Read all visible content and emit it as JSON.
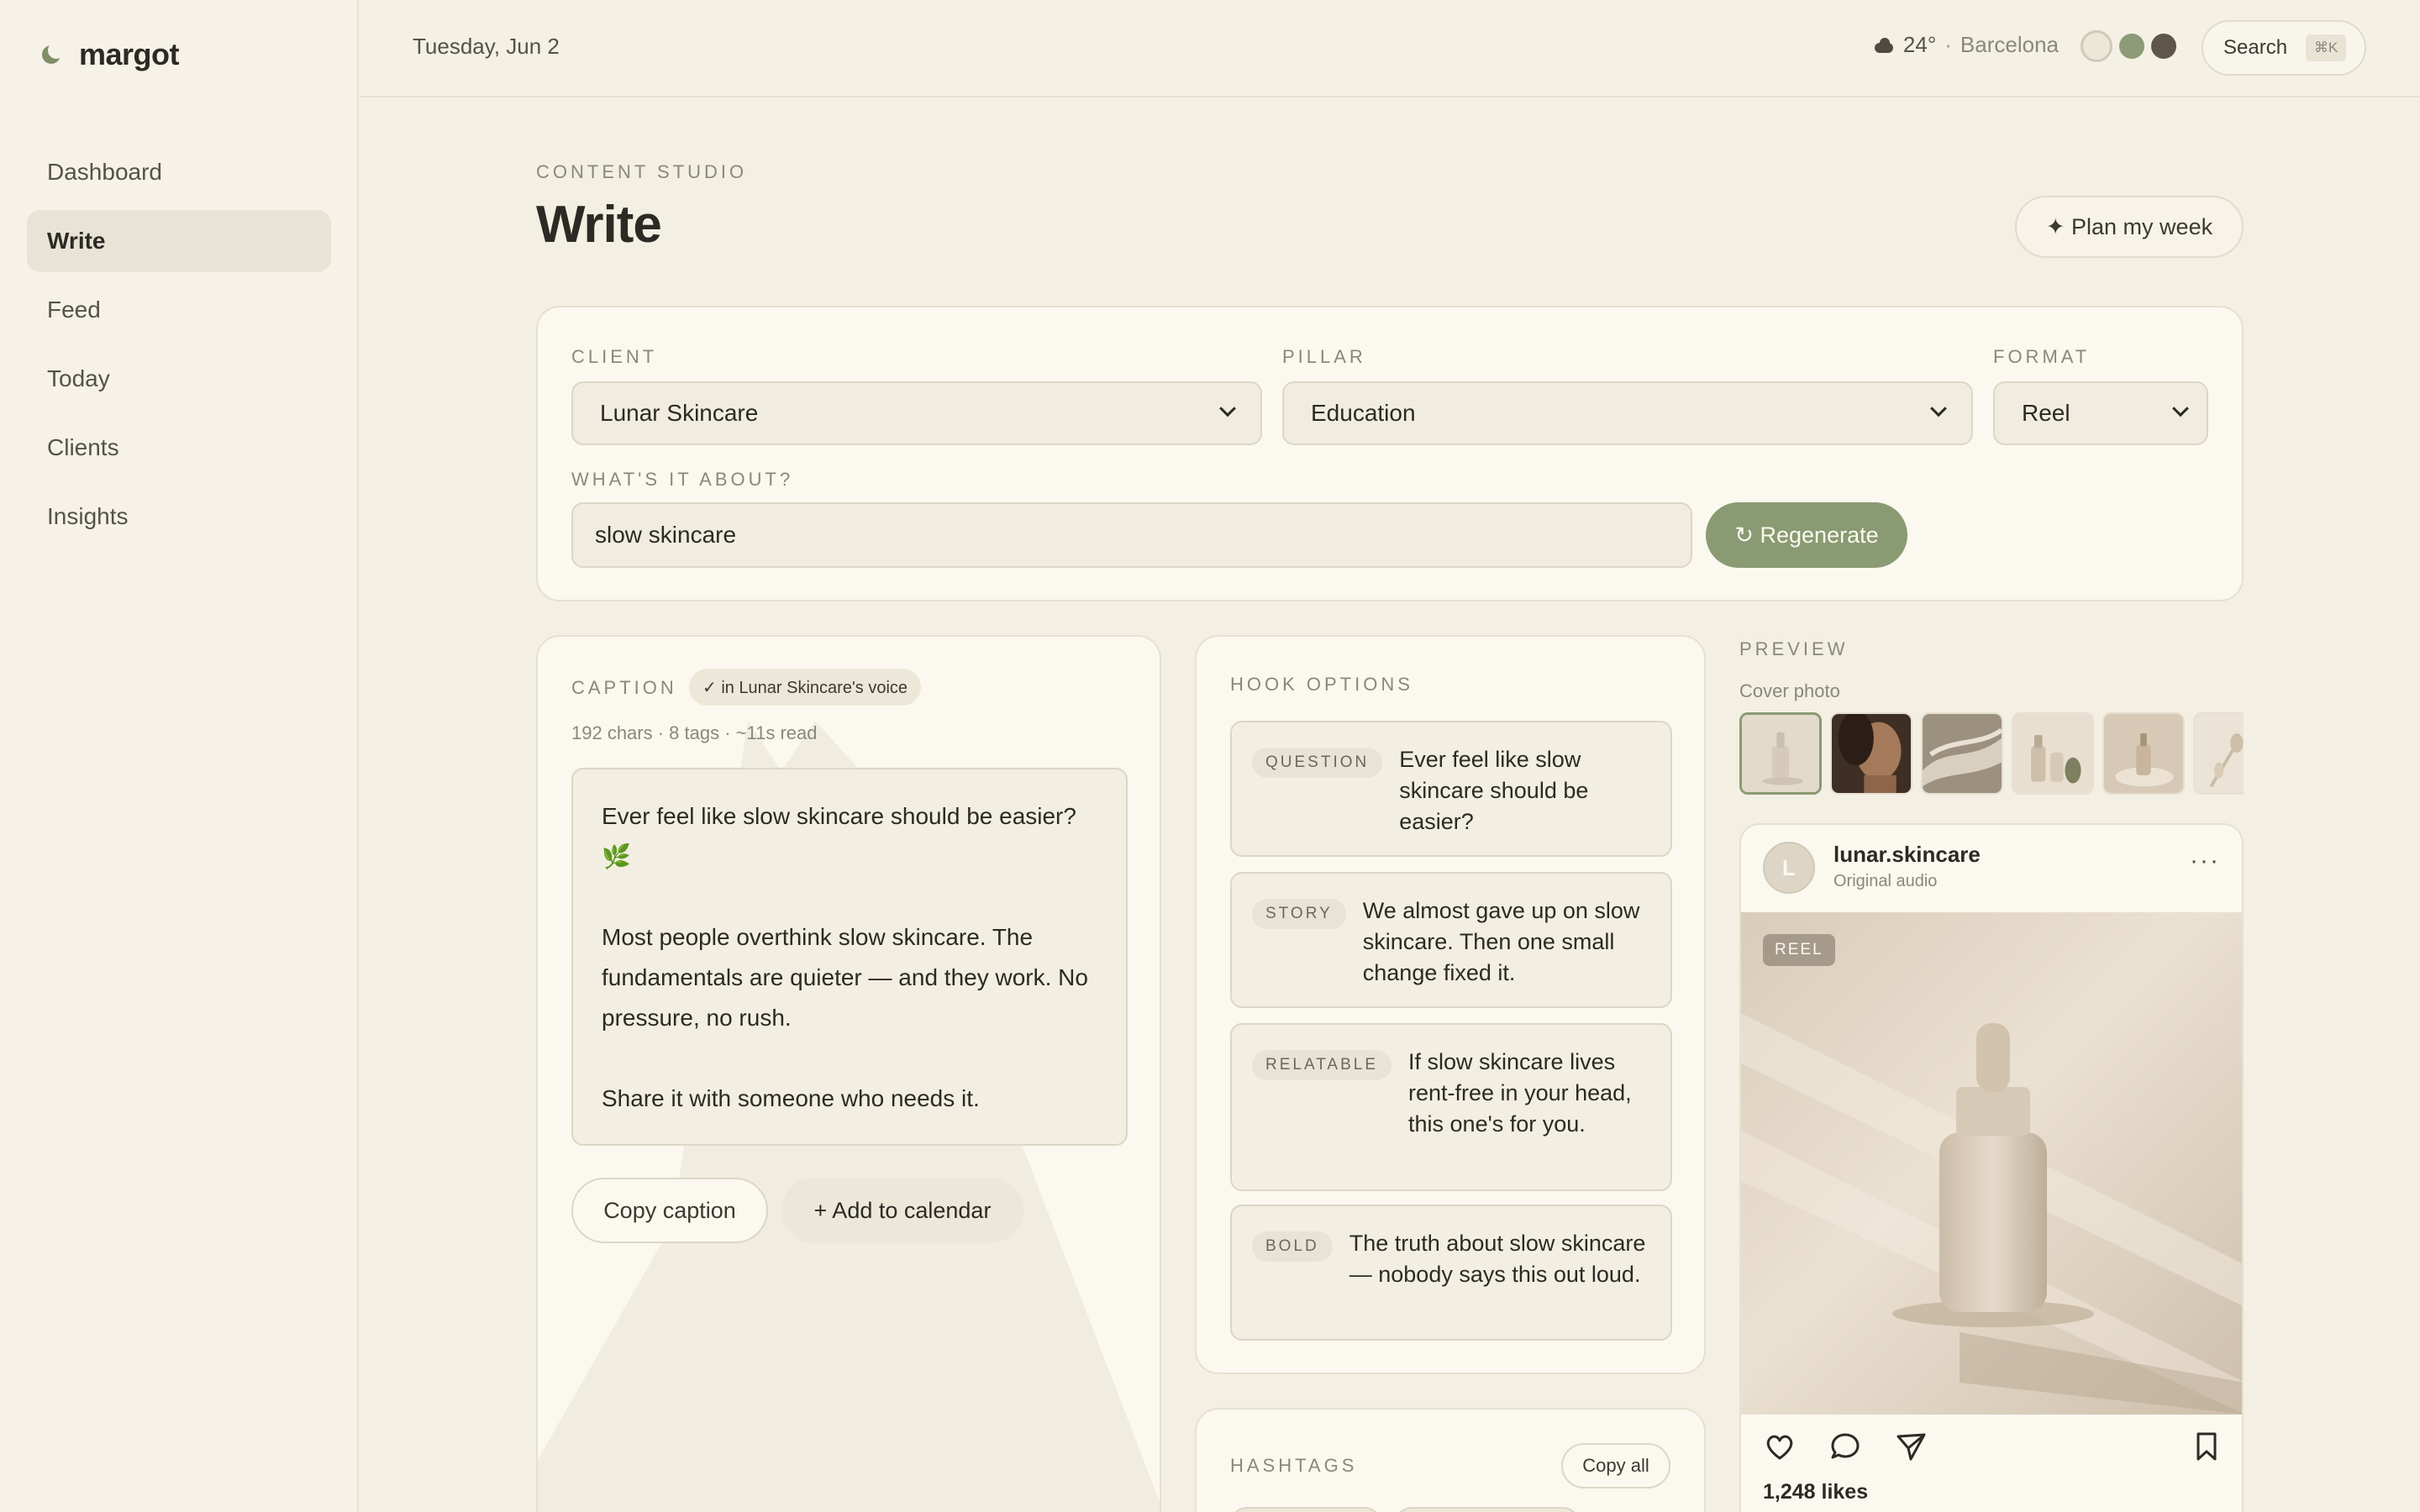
{
  "app": {
    "name": "margot"
  },
  "sidebar": {
    "items": [
      {
        "label": "Dashboard",
        "active": false
      },
      {
        "label": "Write",
        "active": true
      },
      {
        "label": "Feed",
        "active": false
      },
      {
        "label": "Today",
        "active": false
      },
      {
        "label": "Clients",
        "active": false
      },
      {
        "label": "Insights",
        "active": false
      }
    ]
  },
  "topbar": {
    "date": "Tuesday, Jun 2",
    "weather": {
      "temp": "24°",
      "separator": "·",
      "city": "Barcelona",
      "icon": "cloud-icon"
    },
    "themes": [
      "#ece7d6",
      "#8d9b78",
      "#5f564a"
    ],
    "search": {
      "label": "Search",
      "shortcut": "⌘K"
    }
  },
  "header": {
    "eyebrow": "CONTENT STUDIO",
    "title": "Write",
    "plan_button": "✦ Plan my week"
  },
  "form": {
    "client": {
      "label": "CLIENT",
      "value": "Lunar Skincare"
    },
    "pillar": {
      "label": "PILLAR",
      "value": "Education"
    },
    "format": {
      "label": "FORMAT",
      "value": "Reel"
    },
    "topic": {
      "label": "WHAT'S IT ABOUT?",
      "value": "slow skincare"
    },
    "regenerate": "↻ Regenerate"
  },
  "caption": {
    "label": "CAPTION",
    "voice_badge": "✓ in Lunar Skincare's voice",
    "stats": "192 chars · 8 tags · ~11s read",
    "paragraphs": [
      "Ever feel like slow skincare should be easier? 🌿",
      "Most people overthink slow skincare. The fundamentals are quieter — and they work. No pressure, no rush.",
      "Share it with someone who needs it."
    ],
    "copy_button": "Copy caption",
    "calendar_button": "+ Add to calendar"
  },
  "hooks": {
    "label": "HOOK OPTIONS",
    "items": [
      {
        "tag": "QUESTION",
        "text": "Ever feel like slow skincare should be easier?"
      },
      {
        "tag": "STORY",
        "text": "We almost gave up on slow skincare. Then one small change fixed it."
      },
      {
        "tag": "RELATABLE",
        "text": "If slow skincare lives rent-free in your head, this one's for you."
      },
      {
        "tag": "BOLD",
        "text": "The truth about slow skincare — nobody says this out loud."
      }
    ]
  },
  "hashtags": {
    "label": "HASHTAGS",
    "copy_all": "Copy all"
  },
  "preview": {
    "label": "PREVIEW",
    "cover_label": "Cover photo",
    "post": {
      "avatar": "L",
      "handle": "lunar.skincare",
      "audio": "Original audio",
      "more": "···",
      "badge": "REEL",
      "likes": "1,248 likes"
    }
  },
  "colors": {
    "accent": "#8a9a72",
    "background": "#f3efe3",
    "card": "#fbf8ef"
  }
}
